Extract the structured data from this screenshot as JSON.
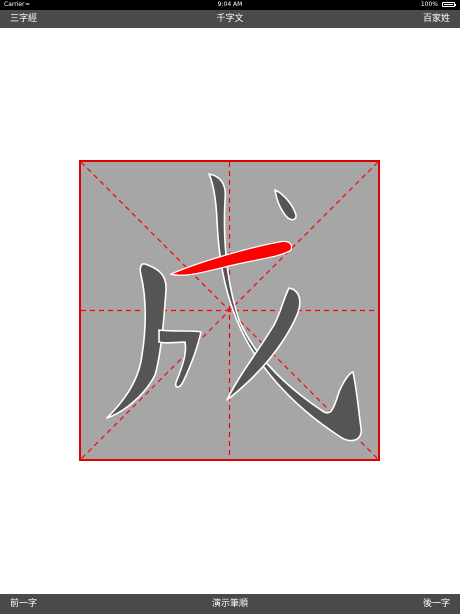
{
  "status_bar": {
    "carrier": "Carrier",
    "wifi_icon": "wifi-icon",
    "time": "9:04 AM",
    "battery_percent": "100%",
    "battery_icon": "battery-icon"
  },
  "nav_bar": {
    "left_label": "三字經",
    "title": "千字文",
    "right_label": "百家姓"
  },
  "practice_grid": {
    "character": "成",
    "background_color": "#a6a6a6",
    "border_color": "#e00000",
    "guide_color": "#ff0000",
    "stroke_color": "#555555",
    "stroke_outline_color": "#ffffff",
    "highlight_stroke_color": "#ff0000"
  },
  "bottom_toolbar": {
    "prev_label": "前一字",
    "demo_label": "演示筆順",
    "next_label": "後一字"
  }
}
